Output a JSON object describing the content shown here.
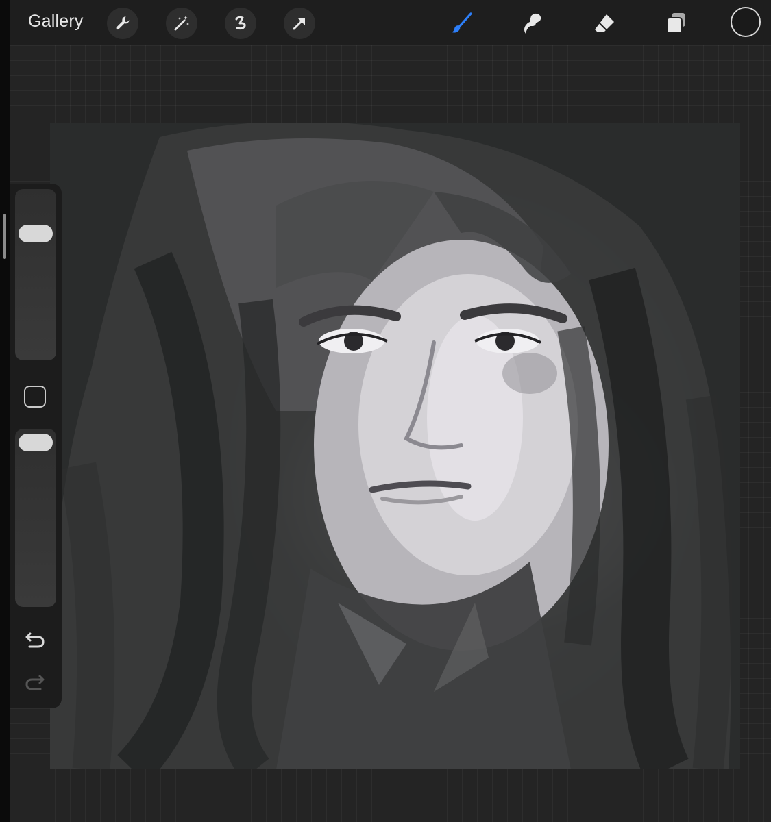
{
  "topbar": {
    "gallery_label": "Gallery",
    "left_tools": [
      "wrench-icon",
      "magic-wand-icon",
      "selection-icon",
      "transform-arrow-icon"
    ],
    "right_tools": [
      "brush-icon",
      "smudge-icon",
      "eraser-icon",
      "layers-icon"
    ],
    "active_tool": "brush",
    "accent_color": "#2d7ff9",
    "current_color": "#1a1a1a"
  },
  "sidebar": {
    "brush_size_level": 0.78,
    "opacity_level": 0.99,
    "buttons": [
      "modify-button",
      "undo-icon",
      "redo-icon"
    ]
  },
  "canvas": {
    "content": "portrait-artwork"
  }
}
